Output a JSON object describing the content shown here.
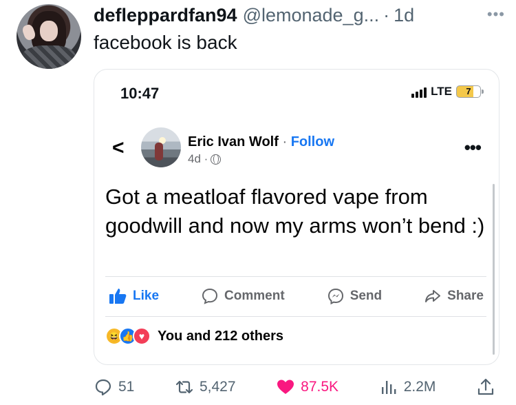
{
  "tweet": {
    "display_name": "defleppardfan94",
    "handle": "@lemonade_g...",
    "dot": "·",
    "time": "1d",
    "text": "facebook is back"
  },
  "embed": {
    "status_bar": {
      "time": "10:47",
      "network": "LTE",
      "battery": "7"
    },
    "post": {
      "author": "Eric Ivan Wolf",
      "separator": "·",
      "follow": "Follow",
      "age": "4d ·",
      "text": "Got a meatloaf flavored vape from goodwill and now my arms won’t bend :)",
      "actions": {
        "like": "Like",
        "comment": "Comment",
        "send": "Send",
        "share": "Share"
      },
      "reactions_text": "You and 212 others"
    }
  },
  "stats": {
    "replies": "51",
    "retweets": "5,427",
    "likes": "87.5K",
    "views": "2.2M"
  },
  "colors": {
    "fb_blue": "#1877f2",
    "like_pink": "#f91880",
    "muted": "#536471"
  },
  "icons": [
    "more-icon",
    "back-chevron-icon",
    "globe-icon",
    "like-icon",
    "comment-icon",
    "send-icon",
    "share-icon",
    "reply-icon",
    "retweet-icon",
    "heart-icon",
    "views-icon",
    "upload-icon"
  ]
}
